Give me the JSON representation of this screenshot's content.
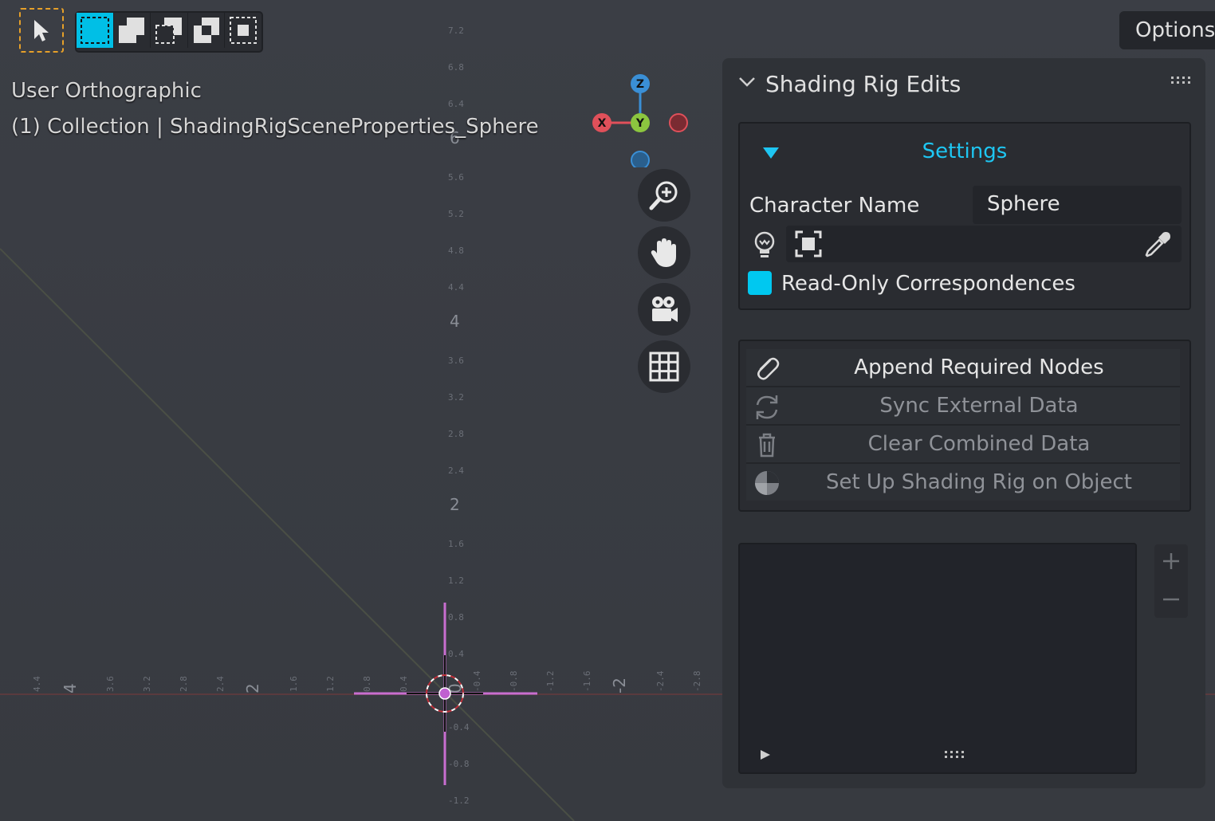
{
  "toolbar": {
    "select_tool_icon": "cursor-arrow-icon",
    "modes": [
      "select-new-icon",
      "select-extend-icon",
      "select-subtract-icon",
      "select-invert-icon",
      "select-intersect-icon"
    ]
  },
  "options_label": "Options",
  "view": {
    "title": "User Orthographic",
    "subtitle": "(1) Collection | ShadingRigSceneProperties_Sphere"
  },
  "gizmo": {
    "z": "Z",
    "x": "X",
    "y": "Y"
  },
  "nav_icons": [
    "zoom-icon",
    "pan-hand-icon",
    "camera-icon",
    "grid-icon"
  ],
  "panel": {
    "title": "Shading Rig Edits",
    "settings": {
      "title": "Settings",
      "character_name_label": "Character Name",
      "character_name_value": "Sphere",
      "read_only_label": "Read-Only Correspondences",
      "read_only_checked": true
    },
    "operations": [
      {
        "label": "Append Required Nodes",
        "icon": "paperclip-icon",
        "enabled": true
      },
      {
        "label": "Sync External Data",
        "icon": "sync-icon",
        "enabled": false
      },
      {
        "label": "Clear Combined Data",
        "icon": "trash-icon",
        "enabled": false
      },
      {
        "label": "Set Up Shading Rig on Object",
        "icon": "shading-sphere-icon",
        "enabled": false
      }
    ]
  },
  "ruler": {
    "vertical_small": [
      "7.2",
      "6.8",
      "6.4",
      "5.6",
      "5.2",
      "4.8",
      "4.4",
      "3.6",
      "3.2",
      "2.8",
      "2.4",
      "1.6",
      "1.2",
      "0.8",
      "0.4",
      "-0.4",
      "-0.8",
      "-1.2"
    ],
    "vertical_big": [
      "6",
      "4",
      "2"
    ],
    "horizontal_small": [
      "4.4",
      "3.6",
      "3.2",
      "2.8",
      "2.4",
      "1.6",
      "1.2",
      "0.8",
      "0.4",
      "-0.4",
      "-0.8",
      "-1.2",
      "-1.6",
      "-2.4",
      "-2.8"
    ],
    "horizontal_big": [
      "4",
      "2",
      "0",
      "-2"
    ]
  },
  "colors": {
    "accent": "#00c8f0",
    "select_tool": "#e6a029",
    "x_axis": "#e0505a",
    "y_axis": "#8cc63f",
    "z_axis": "#3a8fd6",
    "origin": "#c060d0"
  }
}
